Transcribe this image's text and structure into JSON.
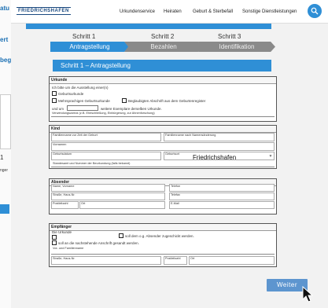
{
  "colors": {
    "accent": "#2f8fd6",
    "button": "#5d95cf",
    "inactive_step": "#8a8a8a"
  },
  "left_peek": {
    "line1": "atu",
    "line2": "ert",
    "line3": "beg",
    "line4": "1",
    "line5": "nger"
  },
  "header": {
    "logo": "FRIEDRICHSHAFEN",
    "nav": [
      "Urkundenservice",
      "Heiraten",
      "Geburt & Sterbefall",
      "Sonstige Dienstleistungen"
    ],
    "search_icon": "search-icon"
  },
  "steps": [
    {
      "number": "Schritt 1",
      "label": "Antragstellung",
      "active": true
    },
    {
      "number": "Schritt 2",
      "label": "Bezahlen",
      "active": false
    },
    {
      "number": "Schritt 3",
      "label": "Identifikation",
      "active": false
    }
  ],
  "section_title": "Schritt 1 – Antragstellung",
  "urkunde": {
    "heading": "Urkunde",
    "intro": "Ich bitte um die Ausstellung einer(n)",
    "opt1": "Geburtsurkunde",
    "opt2": "Mehrsprachigen Geburtsurkunde",
    "opt3": "Beglaubigten Abschrift aus dem Geburtenregister",
    "und_um": "und um",
    "weitere": "weitere Exemplare derselben Urkunde.",
    "verwendung": "Verwendungszweck (z.B. Eheschließung, Einbürgerung, zur Ahnenforschung)"
  },
  "kind": {
    "heading": "Kind",
    "familienname": "Familienname zur Zeit der Geburt",
    "familienname_aktuell": "Familienname nach Namensänderung",
    "vornamen": "Vornamen",
    "geburtsdatum": "Geburtsdatum",
    "geburtsort": "Geburtsort",
    "geburtsort_value": "Friedrichshafen",
    "standesamt": "Standesamt und Nummer der Beurkundung (falls bekannt)"
  },
  "absender": {
    "heading": "Absender",
    "name": "Name, Vorname",
    "telefon": "Telefon",
    "strasse": "Straße, Haus-Nr.",
    "telefax": "Telefax",
    "plz": "Postleitzahl",
    "ort": "Ort",
    "email": "E-Mail"
  },
  "empfaenger": {
    "heading": "Empfänger",
    "die_urkunde": "Die Urkunde",
    "opt1": "soll dem o.g. Absender zugeschickt werden.",
    "opt2": "soll an die nachstehende Anschrift gesandt werden.",
    "name": "Vor- und Familienname",
    "strasse": "Straße, Haus-Nr.",
    "plz": "Postleitzahl",
    "ort": "Ort"
  },
  "actions": {
    "weiter": "Weiter"
  }
}
